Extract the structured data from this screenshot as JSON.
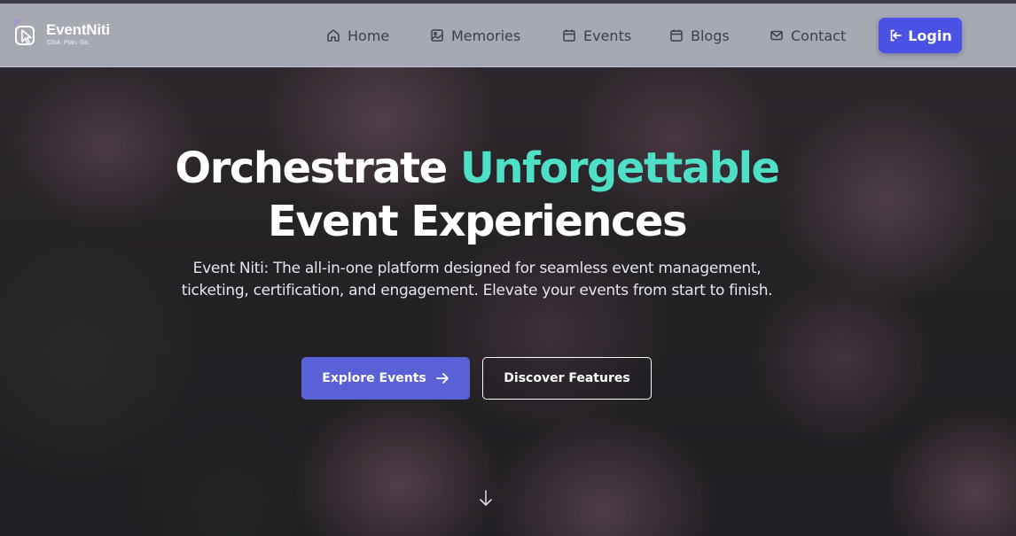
{
  "brand": {
    "name": "EventNiti",
    "tagline": "Click. Plan. Go."
  },
  "nav": {
    "items": [
      {
        "label": "Home",
        "icon": "home-icon"
      },
      {
        "label": "Memories",
        "icon": "image-icon"
      },
      {
        "label": "Events",
        "icon": "calendar-icon"
      },
      {
        "label": "Blogs",
        "icon": "calendar-icon"
      },
      {
        "label": "Contact",
        "icon": "mail-icon"
      }
    ],
    "login_label": "Login"
  },
  "hero": {
    "headline_part1": "Orchestrate ",
    "headline_accent": "Unforgettable",
    "headline_line2": "Event Experiences",
    "subtext": "Event Niti: The all-in-one platform designed for seamless event management, ticketing, certification, and engagement. Elevate your events from start to finish.",
    "primary_button": "Explore Events",
    "secondary_button": "Discover Features"
  },
  "colors": {
    "navbar_bg": "#a6a8b2",
    "accent_teal": "#4fdfc6",
    "login_blue": "#4a52e6",
    "primary_button": "#5a60d6"
  }
}
